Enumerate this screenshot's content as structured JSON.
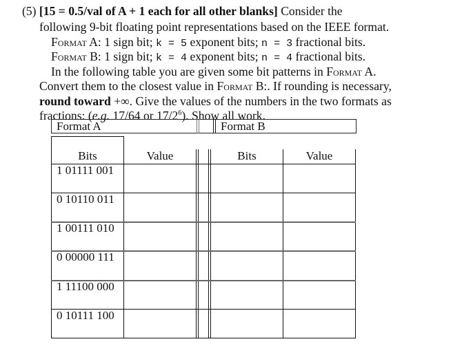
{
  "question": {
    "number": "(5)",
    "points_bold": "[15 = 0.5/val of A + 1 each for all other blanks]",
    "intro_rest": " Consider the",
    "line2": "following 9-bit floating point representations based on the IEEE format.",
    "format_a": {
      "label": "Format",
      "letter": " A: 1 sign bit; ",
      "k_var": "k",
      "k_eq": " = ",
      "k_val": "5",
      "k_rest": " exponent bits; ",
      "n_var": "n",
      "n_eq": " = ",
      "n_val": "3",
      "n_rest": " fractional bits."
    },
    "format_b": {
      "label": "Format",
      "letter": " B: 1 sign bit; ",
      "k_var": "k",
      "k_eq": " = ",
      "k_val": "4",
      "k_rest": " exponent bits; ",
      "n_var": "n",
      "n_eq": " = ",
      "n_val": "4",
      "n_rest": " fractional bits."
    },
    "line5_a": "In the following table you are given some bit patterns in ",
    "line5_sc": "Format",
    "line5_b": " A.",
    "line6_a": "Convert them to the closest value in ",
    "line6_sc": "Format",
    "line6_b": " B:. If rounding is necessary,",
    "line7_bold": "round toward",
    "line7_rest": " +∞. Give the values of the numbers in the two formats as",
    "line8_a": "fractions: (",
    "line8_eg": "e.g.",
    "line8_b": " 17/64 or 17/2",
    "line8_sup": "6",
    "line8_c": "). Show all work."
  },
  "table": {
    "group_headers": [
      "Format A",
      "Format B"
    ],
    "column_headers": [
      "Bits",
      "Value",
      "Bits",
      "Value"
    ],
    "rows": [
      {
        "a_bits": "1 01111 001",
        "a_value": "",
        "b_bits": "",
        "b_value": ""
      },
      {
        "a_bits": "0 10110 011",
        "a_value": "",
        "b_bits": "",
        "b_value": ""
      },
      {
        "a_bits": "1 00111 010",
        "a_value": "",
        "b_bits": "",
        "b_value": ""
      },
      {
        "a_bits": "0 00000 111",
        "a_value": "",
        "b_bits": "",
        "b_value": ""
      },
      {
        "a_bits": "1 11100 000",
        "a_value": "",
        "b_bits": "",
        "b_value": ""
      },
      {
        "a_bits": "0 10111 100",
        "a_value": "",
        "b_bits": "",
        "b_value": ""
      }
    ]
  }
}
